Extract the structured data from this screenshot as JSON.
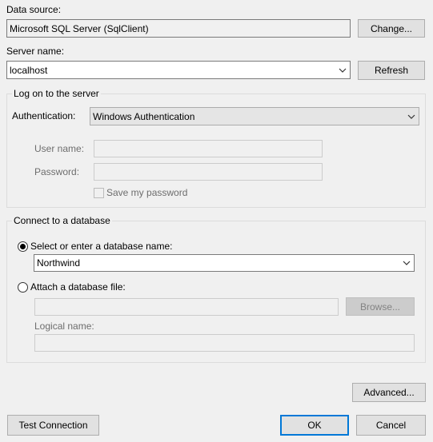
{
  "data_source": {
    "label": "Data source:",
    "value": "Microsoft SQL Server (SqlClient)",
    "change_button": "Change..."
  },
  "server": {
    "label": "Server name:",
    "value": "localhost",
    "refresh_button": "Refresh"
  },
  "logon": {
    "title": "Log on to the server",
    "auth_label": "Authentication:",
    "auth_value": "Windows Authentication",
    "username_label": "User name:",
    "username_value": "",
    "password_label": "Password:",
    "password_value": "",
    "save_password_label": "Save my password",
    "save_password_checked": false
  },
  "database": {
    "title": "Connect to a database",
    "select_option_label": "Select or enter a database name:",
    "select_option_selected": true,
    "database_name": "Northwind",
    "attach_option_label": "Attach a database file:",
    "attach_file_value": "",
    "browse_button": "Browse...",
    "logical_name_label": "Logical name:",
    "logical_name_value": ""
  },
  "buttons": {
    "advanced": "Advanced...",
    "test_connection": "Test Connection",
    "ok": "OK",
    "cancel": "Cancel"
  },
  "colors": {
    "background": "#f0f0f0",
    "accent_focus": "#0078d7",
    "disabled_text": "#6d6d6d"
  },
  "icons": {
    "dropdown": "chevron-down-icon",
    "radio_selected": "radio-selected-icon",
    "radio_unselected": "radio-unselected-icon",
    "checkbox": "checkbox-icon"
  }
}
